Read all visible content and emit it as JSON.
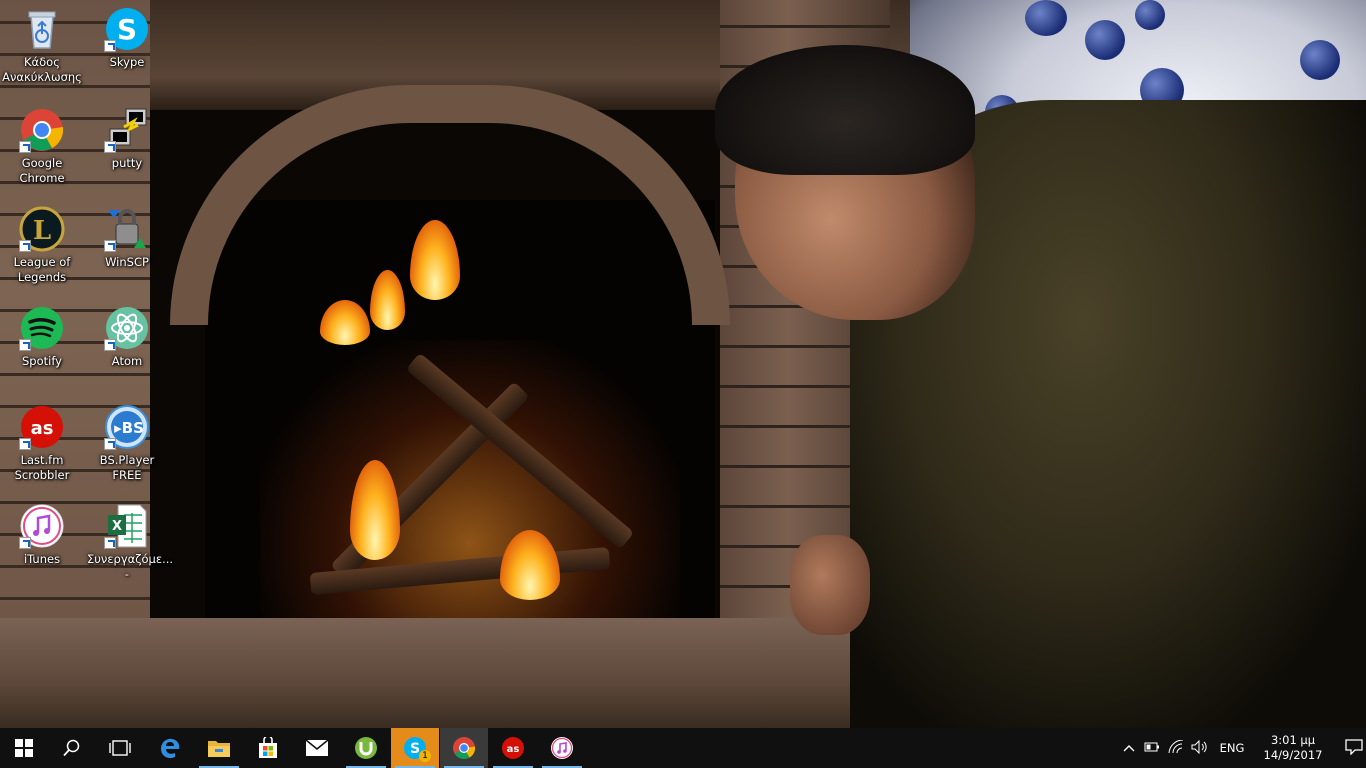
{
  "desktop": {
    "icons": [
      {
        "label": "Κάδος Ανακύκλωσης",
        "icon": "recycle-bin-icon"
      },
      {
        "label": "Skype",
        "icon": "skype-icon"
      },
      {
        "label": "Google Chrome",
        "icon": "chrome-icon"
      },
      {
        "label": "putty",
        "icon": "putty-icon"
      },
      {
        "label": "League of Legends",
        "icon": "league-of-legends-icon"
      },
      {
        "label": "WinSCP",
        "icon": "winscp-icon"
      },
      {
        "label": "Spotify",
        "icon": "spotify-icon"
      },
      {
        "label": "Atom",
        "icon": "atom-icon"
      },
      {
        "label": "Last.fm Scrobbler",
        "icon": "lastfm-icon"
      },
      {
        "label": "BS.Player FREE",
        "icon": "bsplayer-icon"
      },
      {
        "label": "iTunes",
        "icon": "itunes-icon"
      },
      {
        "label": "Συνεργαζόμε... -",
        "icon": "excel-file-icon"
      }
    ]
  },
  "taskbar": {
    "start": "windows-start-icon",
    "search": "search-icon",
    "task_view": "task-view-icon",
    "apps": [
      {
        "name": "Microsoft Edge",
        "icon": "edge-icon",
        "running": false
      },
      {
        "name": "File Explorer",
        "icon": "file-explorer-icon",
        "running": true
      },
      {
        "name": "Store",
        "icon": "store-icon",
        "running": false
      },
      {
        "name": "Mail",
        "icon": "mail-icon",
        "running": false
      },
      {
        "name": "uTorrent",
        "icon": "utorrent-icon",
        "running": true
      },
      {
        "name": "Skype",
        "icon": "skype-icon",
        "running": true,
        "badge": "1"
      },
      {
        "name": "Google Chrome",
        "icon": "chrome-icon",
        "running": true,
        "active": true
      },
      {
        "name": "Last.fm Scrobbler",
        "icon": "lastfm-icon",
        "running": true
      },
      {
        "name": "iTunes",
        "icon": "itunes-icon",
        "running": true
      }
    ],
    "tray": {
      "chevron": "^",
      "language": "ENG",
      "time": "3:01 μμ",
      "date": "14/9/2017"
    }
  },
  "colors": {
    "taskbar_bg": "#101010",
    "running_indicator": "#76b9ed",
    "skype_blue": "#00aff0",
    "chrome_red": "#db4437",
    "spotify_green": "#1db954",
    "lastfm_red": "#d51007"
  }
}
